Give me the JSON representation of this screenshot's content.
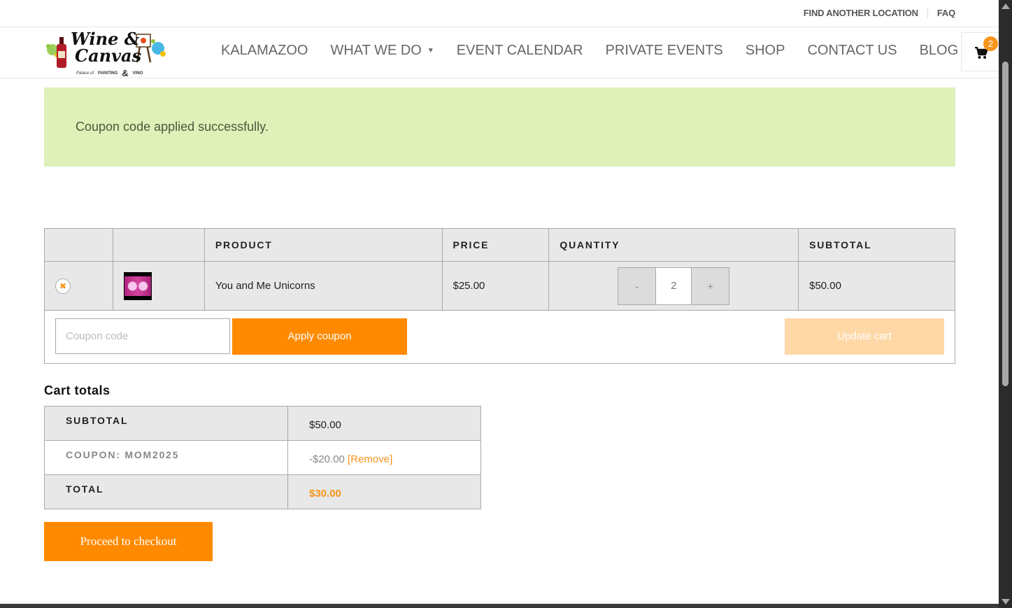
{
  "topbar": {
    "find_location": "FIND ANOTHER LOCATION",
    "faq": "FAQ"
  },
  "logo": {
    "line1": "Wine &",
    "line2": "Canvas",
    "tagline_left": "Palace of",
    "tagline_mid": "PAINTING",
    "tagline_right": "VINO"
  },
  "nav": {
    "items": [
      {
        "label": "KALAMAZOO"
      },
      {
        "label": "WHAT WE DO",
        "has_dropdown": true
      },
      {
        "label": "EVENT CALENDAR"
      },
      {
        "label": "PRIVATE EVENTS"
      },
      {
        "label": "SHOP"
      },
      {
        "label": "CONTACT US"
      },
      {
        "label": "BLOG"
      }
    ],
    "caret": "▼"
  },
  "cart": {
    "icon": "shopping-cart-icon",
    "count": "2"
  },
  "notice": {
    "message": "Coupon code applied successfully."
  },
  "cart_table": {
    "headers": {
      "remove": "",
      "thumbnail": "",
      "product": "PRODUCT",
      "price": "PRICE",
      "quantity": "QUANTITY",
      "subtotal": "SUBTOTAL"
    },
    "items": [
      {
        "remove_icon": "✖",
        "product": "You and Me Unicorns",
        "price": "$25.00",
        "quantity": "2",
        "subtotal": "$50.00"
      }
    ],
    "qty_minus": "-",
    "qty_plus": "+",
    "coupon_placeholder": "Coupon code",
    "apply_coupon": "Apply coupon",
    "update_cart": "Update cart"
  },
  "totals": {
    "title": "Cart totals",
    "subtotal_label": "SUBTOTAL",
    "subtotal_value": "$50.00",
    "coupon_label": "COUPON: MOM2025",
    "coupon_value": "-$20.00",
    "coupon_remove": "[Remove]",
    "total_label": "TOTAL",
    "total_value": "$30.00",
    "checkout": "Proceed to checkout"
  },
  "colors": {
    "accent": "#ff8a00",
    "notice_bg": "#dff0b8",
    "table_bg": "#e8e8e8"
  }
}
